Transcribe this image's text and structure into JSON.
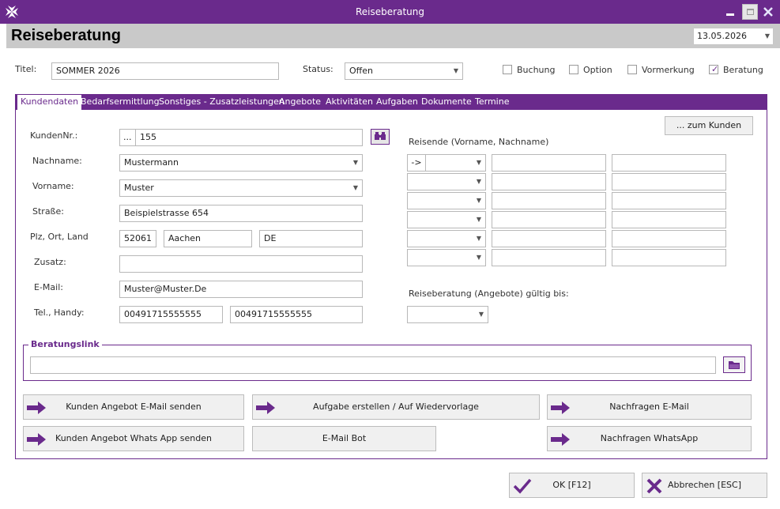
{
  "window": {
    "title": "Reiseberatung"
  },
  "header": {
    "heading": "Reiseberatung",
    "date": "13.05.2026"
  },
  "top": {
    "titel_label": "Titel:",
    "titel_value": "SOMMER 2026",
    "status_label": "Status:",
    "status_value": "Offen",
    "checkboxes": [
      {
        "label": "Buchung",
        "checked": false
      },
      {
        "label": "Option",
        "checked": false
      },
      {
        "label": "Vormerkung",
        "checked": false
      },
      {
        "label": "Beratung",
        "checked": true
      }
    ]
  },
  "tabs": [
    {
      "label": "Kundendaten",
      "active": true
    },
    {
      "label": "Bedarfsermittlung",
      "active": false
    },
    {
      "label": "Sonstiges - Zusatzleistungen",
      "active": false
    },
    {
      "label": "Angebote",
      "active": false
    },
    {
      "label": "Aktivitäten",
      "active": false
    },
    {
      "label": "Aufgaben",
      "active": false
    },
    {
      "label": "Dokumente",
      "active": false
    },
    {
      "label": "Termine",
      "active": false
    }
  ],
  "customer": {
    "kundennr_label": "KundenNr.:",
    "kundennr_prefix": "...",
    "kundennr_value": "155",
    "nachname_label": "Nachname:",
    "nachname_value": "Mustermann",
    "vorname_label": "Vorname:",
    "vorname_value": "Muster",
    "strasse_label": "Straße:",
    "strasse_value": "Beispielstrasse 654",
    "plz_label": "Plz, Ort, Land",
    "plz_value": "52061",
    "ort_value": "Aachen",
    "land_value": "DE",
    "zusatz_label": "Zusatz:",
    "zusatz_value": "",
    "email_label": "E-Mail:",
    "email_value": "Muster@Muster.De",
    "tel_label": "Tel., Handy:",
    "tel_value": "00491715555555",
    "handy_value": "00491715555555"
  },
  "right": {
    "zum_kunden_button": "... zum Kunden",
    "reisende_label": "Reisende (Vorname, Nachname)",
    "first_row_prefix": "->",
    "gueltig_label": "Reiseberatung (Angebote) gültig bis:"
  },
  "link": {
    "legend": "Beratungslink",
    "value": ""
  },
  "actions": {
    "angebot_email": "Kunden Angebot E-Mail senden",
    "aufgabe": "Aufgabe erstellen / Auf Wiedervorlage",
    "nachfragen_email": "Nachfragen E-Mail",
    "angebot_whatsapp": "Kunden Angebot Whats App senden",
    "email_bot": "E-Mail Bot",
    "nachfragen_whatsapp": "Nachfragen WhatsApp"
  },
  "footer": {
    "ok": "OK [F12]",
    "cancel": "Abbrechen [ESC]"
  },
  "colors": {
    "accent": "#6a2a8c",
    "header_bg": "#c9c9c9",
    "button_bg": "#f0f0f0"
  },
  "icons": {
    "app": "maltese-cross-icon",
    "binoculars": "binoculars-icon",
    "folder": "folder-icon",
    "arrow": "arrow-right-icon",
    "ok": "check-icon",
    "cancel": "cross-icon"
  }
}
